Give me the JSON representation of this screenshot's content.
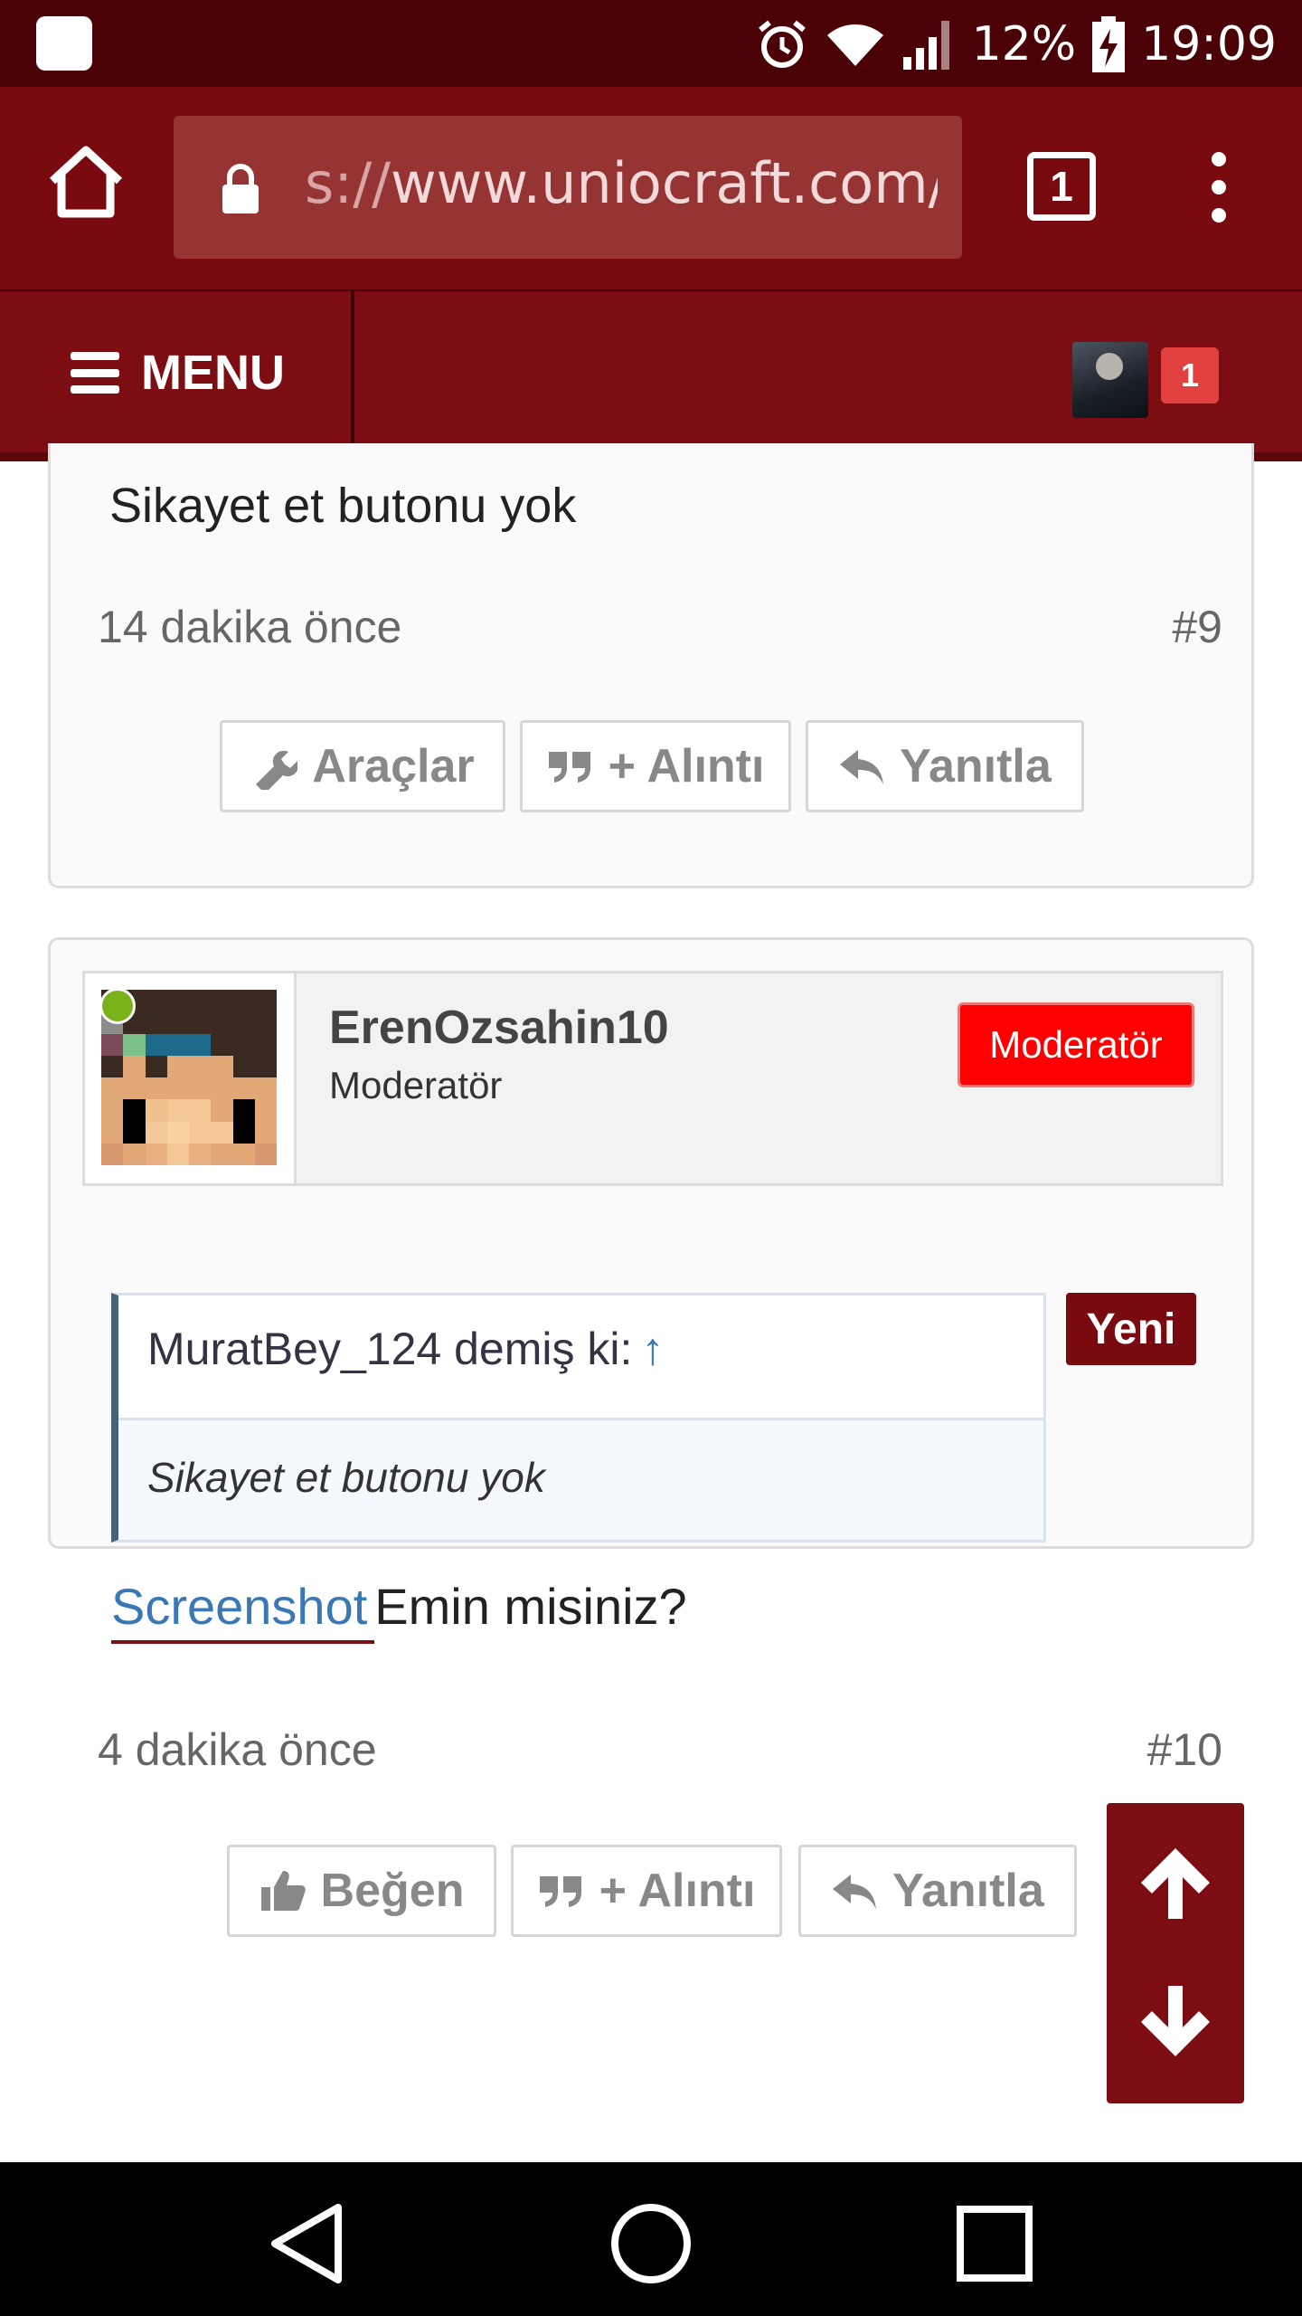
{
  "status_bar": {
    "battery": "12%",
    "time": "19:09",
    "icons": [
      "alarm-icon",
      "wifi-icon",
      "signal-icon",
      "battery-charging-icon"
    ]
  },
  "browser": {
    "url_scheme": "s://",
    "url_host": "www.uniocraft.com/k",
    "tab_count": "1"
  },
  "nav": {
    "menu_label": "MENU",
    "notification_count": "1"
  },
  "posts": [
    {
      "text": "Sikayet et butonu yok",
      "time": "14 dakika önce",
      "number": "#9",
      "actions": [
        "Araçlar",
        "+ Alıntı",
        "Yanıtla"
      ]
    },
    {
      "author": "ErenOzsahin10",
      "author_title": "Moderatör",
      "badge": "Moderatör",
      "new_label": "Yeni",
      "quote_author": "MuratBey_124 demiş ki:",
      "quote_arrow": "↑",
      "quote_text": "Sikayet et butonu yok",
      "link_text": "Screenshot",
      "text": "Emin misiniz?",
      "time": "4 dakika önce",
      "number": "#10",
      "actions": [
        "Beğen",
        "+ Alıntı",
        "Yanıtla"
      ]
    }
  ],
  "colors": {
    "status_bar": "#4b0207",
    "brand": "#790a10",
    "moderator_badge": "#ff0000",
    "link": "#3a78b5",
    "online": "#7ab21a"
  }
}
